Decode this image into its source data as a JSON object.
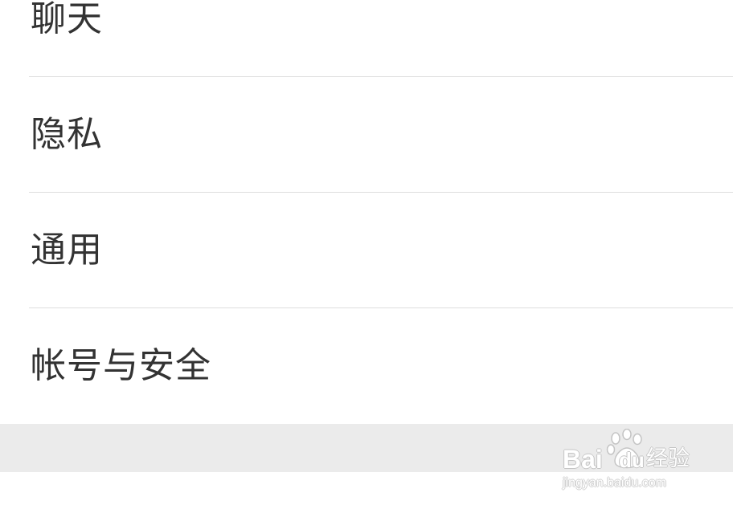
{
  "settings": {
    "items": [
      {
        "label": "聊天"
      },
      {
        "label": "隐私"
      },
      {
        "label": "通用"
      },
      {
        "label": "帐号与安全"
      }
    ]
  },
  "watermark": {
    "brand_left": "Bai",
    "brand_right": "du",
    "brand_cn": "经验",
    "url": "jingyan.baidu.com",
    "icon": "paw-icon"
  },
  "colors": {
    "background": "#ffffff",
    "text": "#333333",
    "divider": "#dedede",
    "band": "#ebebeb"
  }
}
